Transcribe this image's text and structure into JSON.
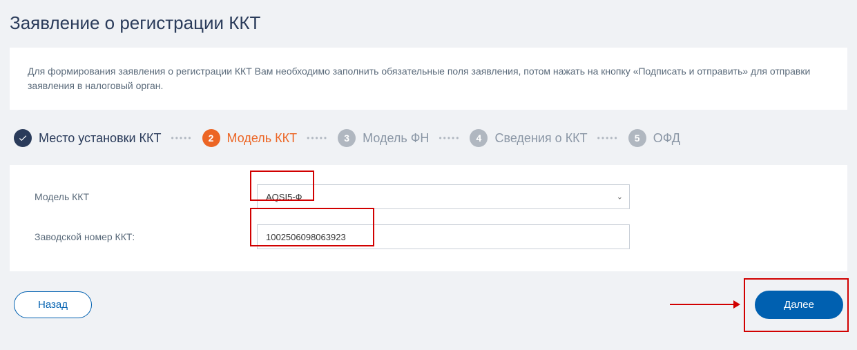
{
  "page_title": "Заявление о регистрации ККТ",
  "info_text": "Для формирования заявления о регистрации ККТ Вам необходимо заполнить обязательные поля заявления, потом нажать на кнопку «Подписать и отправить» для отправки заявления в налоговый орган.",
  "steps": [
    {
      "num": "✓",
      "label": "Место установки ККТ",
      "state": "completed"
    },
    {
      "num": "2",
      "label": "Модель ККТ",
      "state": "active"
    },
    {
      "num": "3",
      "label": "Модель ФН",
      "state": "pending"
    },
    {
      "num": "4",
      "label": "Сведения о ККТ",
      "state": "pending"
    },
    {
      "num": "5",
      "label": "ОФД",
      "state": "pending"
    }
  ],
  "form": {
    "model_label": "Модель ККТ",
    "model_value": "AQSI5-Ф",
    "serial_label": "Заводской номер ККТ:",
    "serial_value": "1002506098063923"
  },
  "buttons": {
    "back": "Назад",
    "next": "Далее"
  }
}
